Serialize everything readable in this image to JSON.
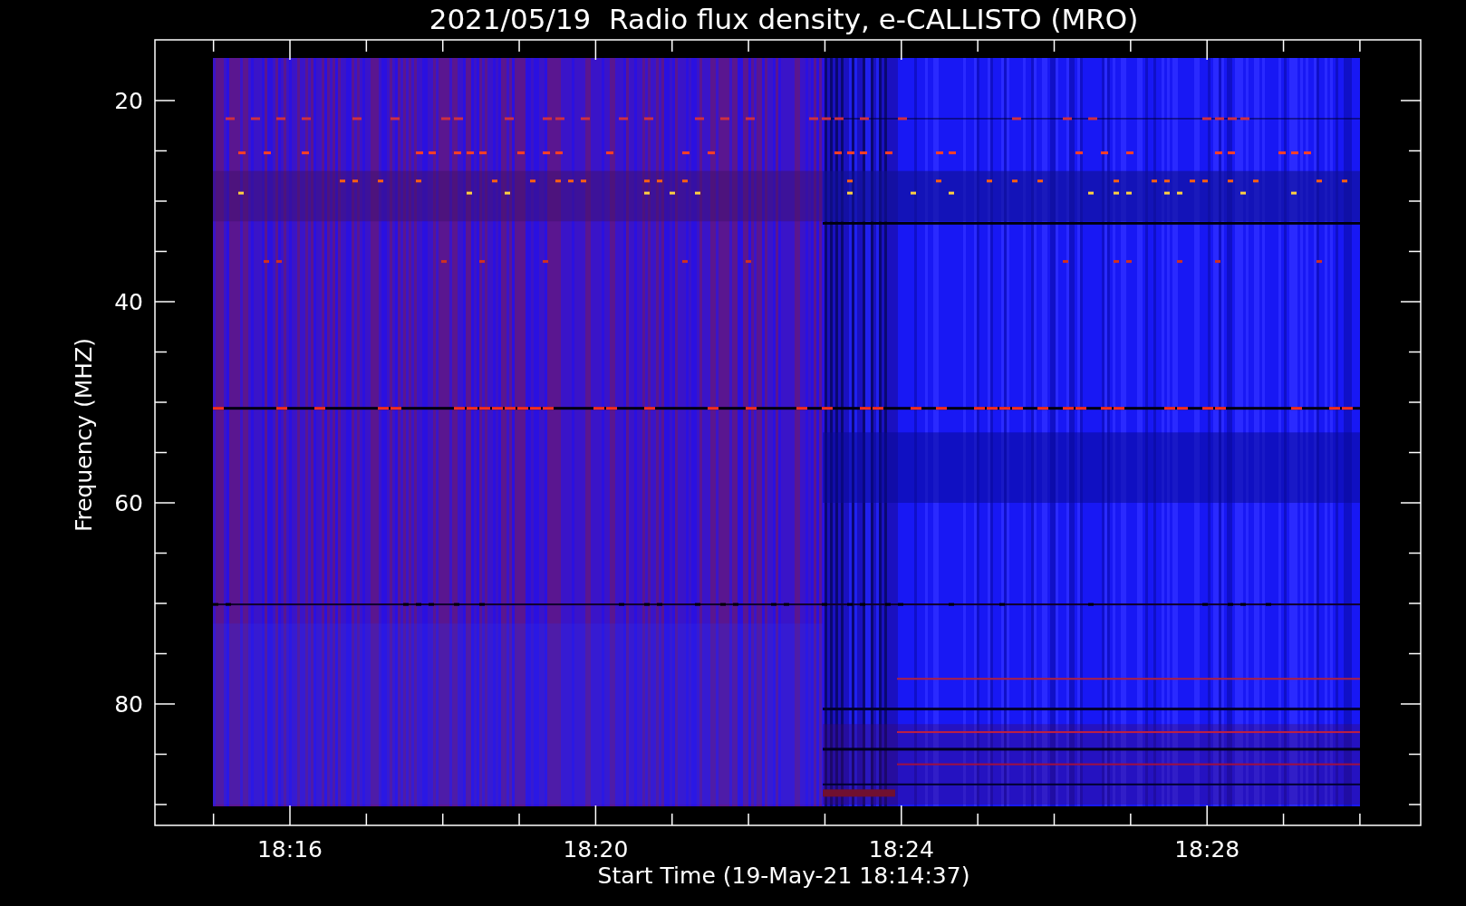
{
  "title": "2021/05/19  Radio flux density, e-CALLISTO (MRO)",
  "plot": {
    "ylabel": "Frequency (MHZ)",
    "xlabel": "Start Time (19-May-21 18:14:37)",
    "yticks": [
      "20",
      "40",
      "60",
      "80"
    ],
    "xticks": [
      "18:16",
      "18:20",
      "18:24",
      "18:28"
    ]
  }
}
